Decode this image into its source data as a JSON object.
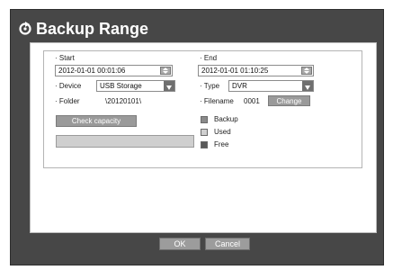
{
  "dialog": {
    "title": "Backup Range"
  },
  "start": {
    "label": "Start",
    "value": "2012-01-01 00:01:06"
  },
  "end": {
    "label": "End",
    "value": "2012-01-01 01:10:25"
  },
  "device": {
    "label": "Device",
    "value": "USB Storage"
  },
  "type": {
    "label": "Type",
    "value": "DVR"
  },
  "folder": {
    "label": "Folder",
    "value": "\\20120101\\"
  },
  "filename": {
    "label": "Filename",
    "value": "0001",
    "change_label": "Change"
  },
  "check_capacity_label": "Check capacity",
  "legend": [
    {
      "label": "Backup",
      "color": "#8a8a8a"
    },
    {
      "label": "Used",
      "color": "#d0d0d0"
    },
    {
      "label": "Free",
      "color": "#5a5a5a"
    }
  ],
  "footer": {
    "ok_label": "OK",
    "cancel_label": "Cancel"
  },
  "colors": {
    "frame": "#474747",
    "panel": "#ffffff",
    "button": "#9a9a9a"
  },
  "icons": {
    "title": "refresh-icon",
    "spin": "spin-arrows-icon",
    "dropdown": "dropdown-arrow-icon"
  }
}
